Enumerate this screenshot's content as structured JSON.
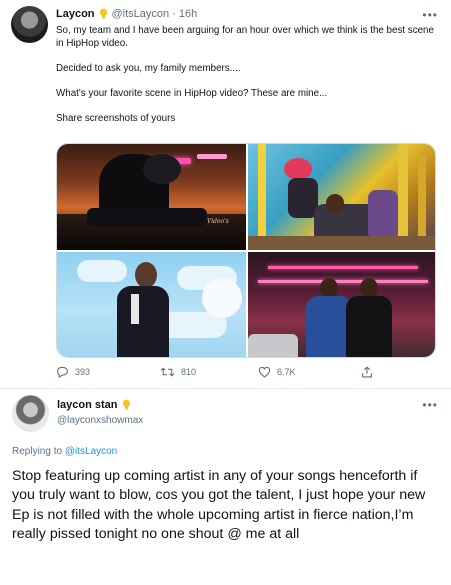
{
  "tweet": {
    "display_name": "Laycon",
    "badge_icon": "lightbulb-icon",
    "handle": "@itsLaycon",
    "separator": "·",
    "time": "16h",
    "more_icon": "more-horizontal-icon",
    "more_label": "•••",
    "paragraphs": [
      "So, my team and I have been arguing for an hour over which we think is the best scene in HipHop video.",
      "Decided to ask you, my family members....",
      "What's your favorite scene in HipHop video? These are mine...",
      "Share screenshots of yours"
    ],
    "media": {
      "watermark": "Video's"
    },
    "actions": {
      "reply_count": "393",
      "retweet_count": "810",
      "like_count": "6.7K"
    }
  },
  "reply": {
    "display_name": "laycon stan",
    "badge_icon": "lightbulb-icon",
    "handle": "@layconxshowmax",
    "more_label": "•••",
    "replying_prefix": "Replying to",
    "replying_to": "@itsLaycon",
    "text": "Stop featuring up coming artist in any of your songs henceforth if you truly want to blow, cos you got the talent, I just hope your new Ep is not filled with the whole upcoming artist in fierce nation,I’m really pissed tonight no one shout @ me at all"
  },
  "colors": {
    "text": "#0f1419",
    "secondary": "#5b7083",
    "link": "#1b95e0",
    "badge": "#f5c518",
    "divider": "#e6ecf0"
  }
}
